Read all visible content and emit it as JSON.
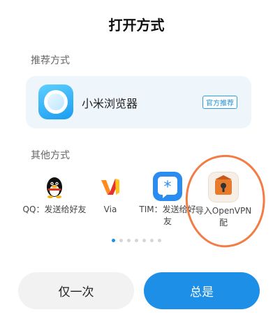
{
  "dialog": {
    "title": "打开方式"
  },
  "recommended": {
    "section_label": "推荐方式",
    "app_name": "小米浏览器",
    "badge": "官方推荐"
  },
  "other": {
    "section_label": "其他方式",
    "apps": [
      {
        "label": "QQ：发送给好友",
        "icon": "qq-penguin-icon"
      },
      {
        "label": "Via",
        "icon": "via-browser-icon"
      },
      {
        "label": "TIM：发送给好友",
        "icon": "tim-star-icon"
      },
      {
        "label": "导入OpenVPN 配",
        "icon": "openvpn-icon"
      }
    ]
  },
  "pager": {
    "total": 7,
    "active": 0
  },
  "buttons": {
    "once": "仅一次",
    "always": "总是"
  },
  "colors": {
    "accent": "#1e8fe6",
    "annotation": "#f37c45",
    "card_bg": "#eef6fb"
  }
}
